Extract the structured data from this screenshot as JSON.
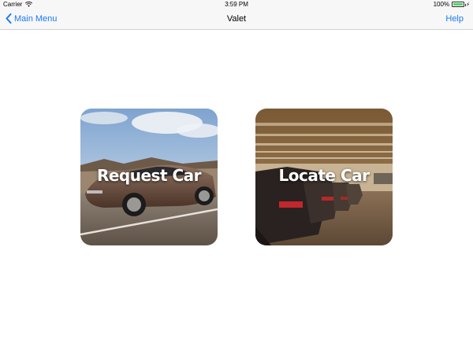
{
  "status_bar": {
    "carrier": "Carrier",
    "time": "3:59 PM",
    "battery": "100%"
  },
  "nav": {
    "back_label": "Main Menu",
    "title": "Valet",
    "help_label": "Help"
  },
  "tiles": [
    {
      "label": "Request Car",
      "image": "car-on-road-photo"
    },
    {
      "label": "Locate Car",
      "image": "parking-garage-photo"
    }
  ],
  "colors": {
    "accent": "#1a7af5",
    "nav_background": "#f7f7f7",
    "battery_green": "#4cd964"
  }
}
